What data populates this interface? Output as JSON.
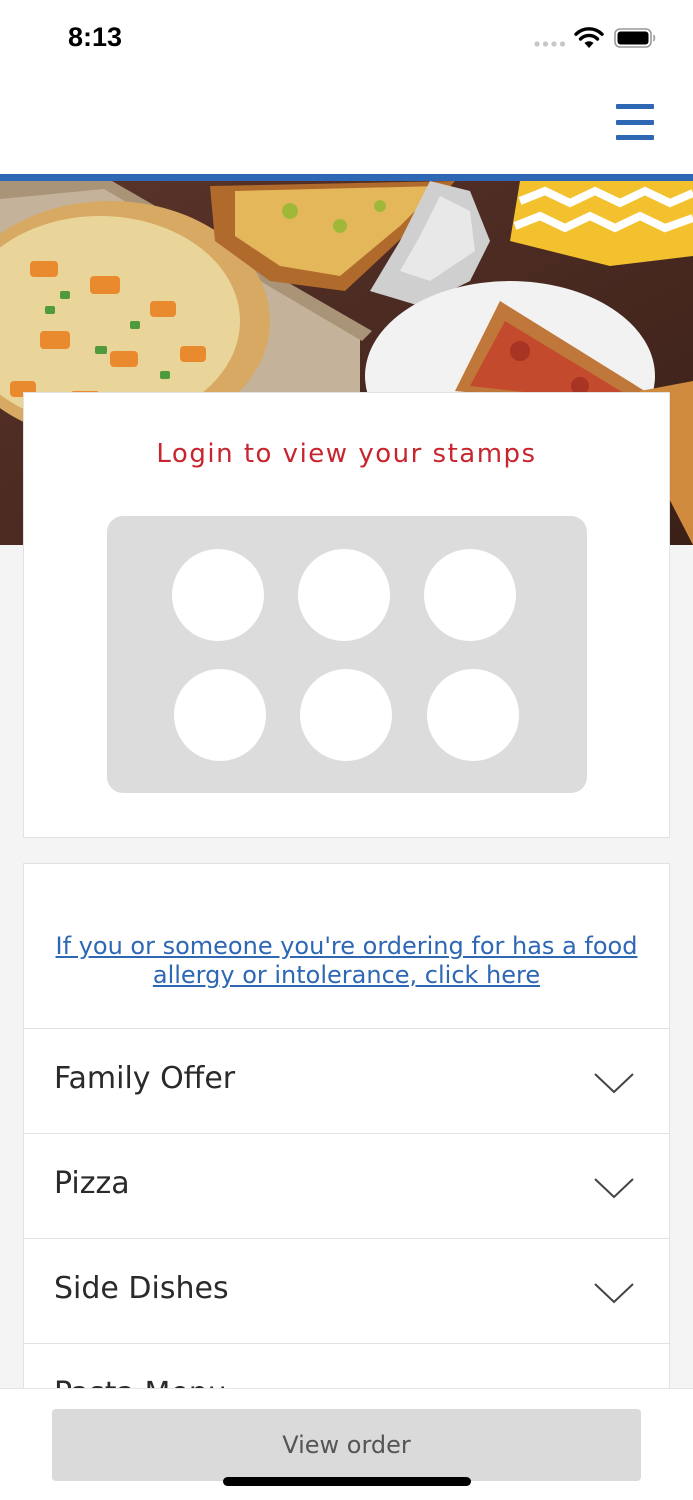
{
  "status_bar": {
    "time": "8:13"
  },
  "header": {
    "menu_icon": "hamburger-menu-icon",
    "accent_color": "#2e67b4"
  },
  "hero": {
    "image_alt": "pizza-hero-image"
  },
  "loyalty": {
    "title": "Login to view your stamps",
    "title_color": "#c8262e",
    "stamp_count": 6
  },
  "menu": {
    "allergy_link": "If you or someone you're ordering for has a food allergy or intolerance, click here",
    "categories": [
      {
        "label": "Family Offer"
      },
      {
        "label": "Pizza"
      },
      {
        "label": "Side Dishes"
      },
      {
        "label": "Pasta Menu"
      }
    ]
  },
  "bottom_bar": {
    "view_order_label": "View order"
  }
}
